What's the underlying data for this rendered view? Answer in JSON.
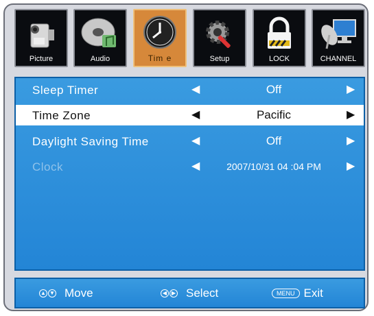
{
  "tabs": [
    {
      "label": "Picture",
      "icon": "camcorder-icon"
    },
    {
      "label": "Audio",
      "icon": "cd-music-icon"
    },
    {
      "label": "Tim e",
      "icon": "clock-icon",
      "active": true
    },
    {
      "label": "Setup",
      "icon": "gear-wrench-icon"
    },
    {
      "label": "LOCK",
      "icon": "padlock-icon"
    },
    {
      "label": "CHANNEL",
      "icon": "satellite-monitor-icon"
    }
  ],
  "menu": {
    "rows": [
      {
        "label": "Sleep Timer",
        "value": "Off",
        "state": "normal"
      },
      {
        "label": "Time Zone",
        "value": "Pacific",
        "state": "selected"
      },
      {
        "label": "Daylight Saving Time",
        "value": "Off",
        "state": "normal"
      },
      {
        "label": "Clock",
        "value": "2007/10/31 04 :04 PM",
        "state": "disabled"
      }
    ],
    "left_arrow": "◀",
    "right_arrow": "▶"
  },
  "footer": {
    "move_label": "Move",
    "select_label": "Select",
    "menu_key": "MENU",
    "exit_label": "Exit"
  },
  "colors": {
    "panel": "#2b8fdc",
    "active_tab": "#d6883a",
    "frame": "#d7d9e0"
  }
}
